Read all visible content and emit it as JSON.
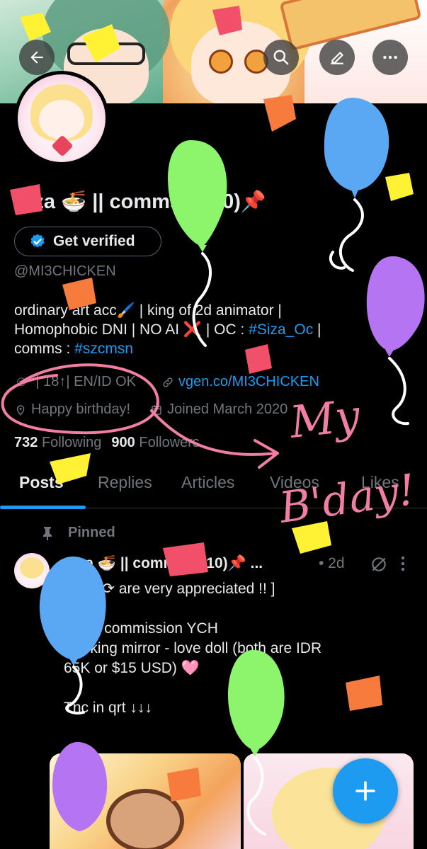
{
  "profile": {
    "name": "Siza 🍜 || comms (5/10)📌",
    "verify_label": "Get verified",
    "handle": "@MI3CHICKEN",
    "bio_line1": "ordinary art acc🖌️ | king of 2d animator |",
    "bio_line2_pre": "Homophobic DNI | NO AI ❌ | OC : ",
    "bio_tag1": "#Siza_Oc",
    "bio_line2_post": " |",
    "bio_line3_pre": "comms : ",
    "bio_tag2": "#szcmsn",
    "meta_info": "| 18↑| EN/ID OK",
    "meta_link": "vgen.co/MI3CHICKEN",
    "birthday": "Happy birthday!",
    "joined": "Joined March 2020",
    "following_count": "732",
    "following_label": "Following",
    "followers_count": "900",
    "followers_label": "Followers"
  },
  "tabs": [
    "Posts",
    "Replies",
    "Articles",
    "Videos",
    "Likes"
  ],
  "post": {
    "pinned_label": "Pinned",
    "header": "Siza 🍜 || comms (5/10)📌 ...",
    "time": "• 2d",
    "line1": "[ ♡ + ⟳ are very appreciated !! ]",
    "line2": "Open commission YCH",
    "line3": "Peeking mirror - love doll (both are IDR",
    "line4": "65K or $15 USD) 🩷",
    "line5": "Tnc in qrt ↓↓↓"
  },
  "doodle": {
    "text_line1": "My",
    "text_line2": "B'day!"
  },
  "icons": {
    "back": "arrow-left-icon",
    "search": "search-icon",
    "edit": "edit-icon",
    "more": "more-icon",
    "verified": "verified-badge-icon",
    "location": "location-icon",
    "calendar": "calendar-icon",
    "link": "link-icon",
    "pin": "pin-icon",
    "fab": "plus-icon"
  },
  "colors": {
    "accent": "#1d9bf0",
    "muted": "#71767b",
    "text": "#e7e9ea",
    "doodle_pink": "#f07fa3"
  }
}
